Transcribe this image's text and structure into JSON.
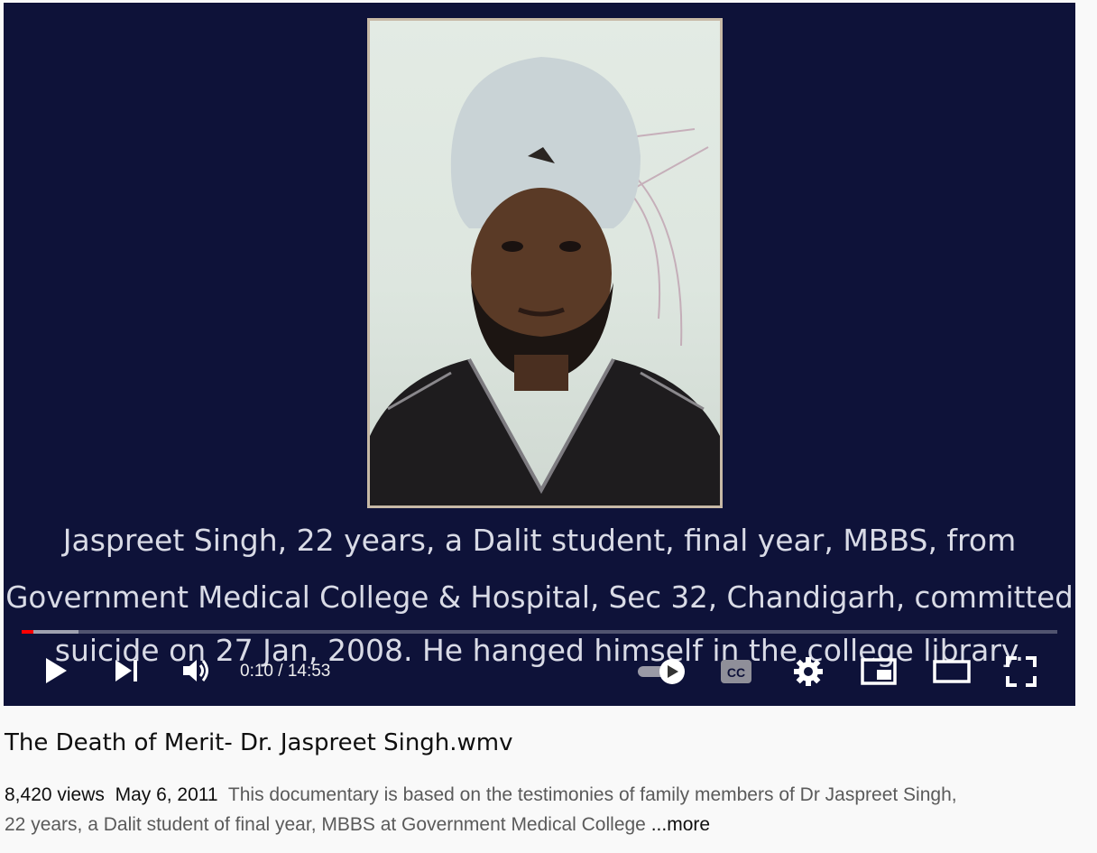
{
  "video": {
    "caption_lines": [
      "Jaspreet Singh, 22 years, a Dalit student, final year, MBBS, from",
      "Government Medical College & Hospital, Sec 32, Chandigarh, committed",
      "suicide on 27 Jan, 2008. He hanged himself in the college library."
    ],
    "time_display": "0:10 / 14:53",
    "progress_fraction": 0.0112,
    "buffered_fraction": 0.055,
    "accent_color": "#ff0000",
    "player_background": "#0e1239"
  },
  "controls": {
    "icons": [
      "play-icon",
      "next-icon",
      "volume-icon",
      "autoplay-toggle-icon",
      "captions-icon",
      "settings-icon",
      "miniplayer-icon",
      "theater-mode-icon",
      "fullscreen-icon"
    ],
    "captions_label": "CC"
  },
  "details": {
    "title": "The Death of Merit- Dr. Jaspreet Singh.wmv",
    "views": "8,420 views",
    "date": "May 6, 2011",
    "description": "This documentary is based on the testimonies of family members of Dr Jaspreet Singh, 22 years, a Dalit student of final year, MBBS at Government Medical College",
    "more_label": "...more"
  }
}
